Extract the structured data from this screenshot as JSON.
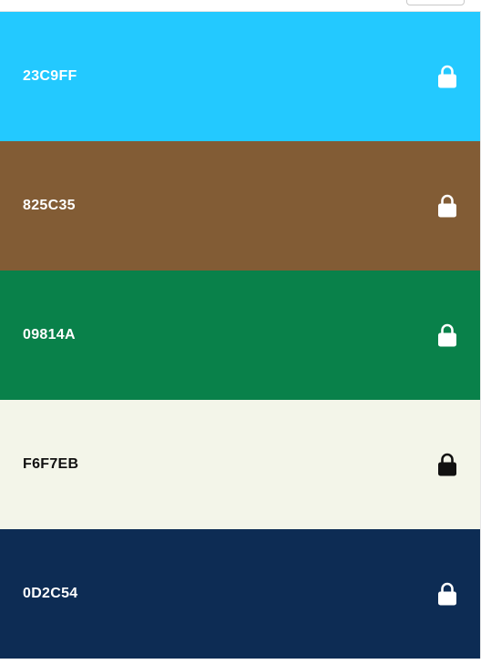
{
  "swatches": [
    {
      "hex": "23C9FF",
      "color": "#23C9FF",
      "text_color": "#ffffff",
      "icon": "lock-icon"
    },
    {
      "hex": "825C35",
      "color": "#825C35",
      "text_color": "#ffffff",
      "icon": "lock-icon"
    },
    {
      "hex": "09814A",
      "color": "#09814A",
      "text_color": "#ffffff",
      "icon": "lock-icon"
    },
    {
      "hex": "F6F7EB",
      "color": "#F3F5E9",
      "text_color": "#111111",
      "icon": "lock-icon"
    },
    {
      "hex": "0D2C54",
      "color": "#0D2C54",
      "text_color": "#ffffff",
      "icon": "lock-icon"
    }
  ]
}
